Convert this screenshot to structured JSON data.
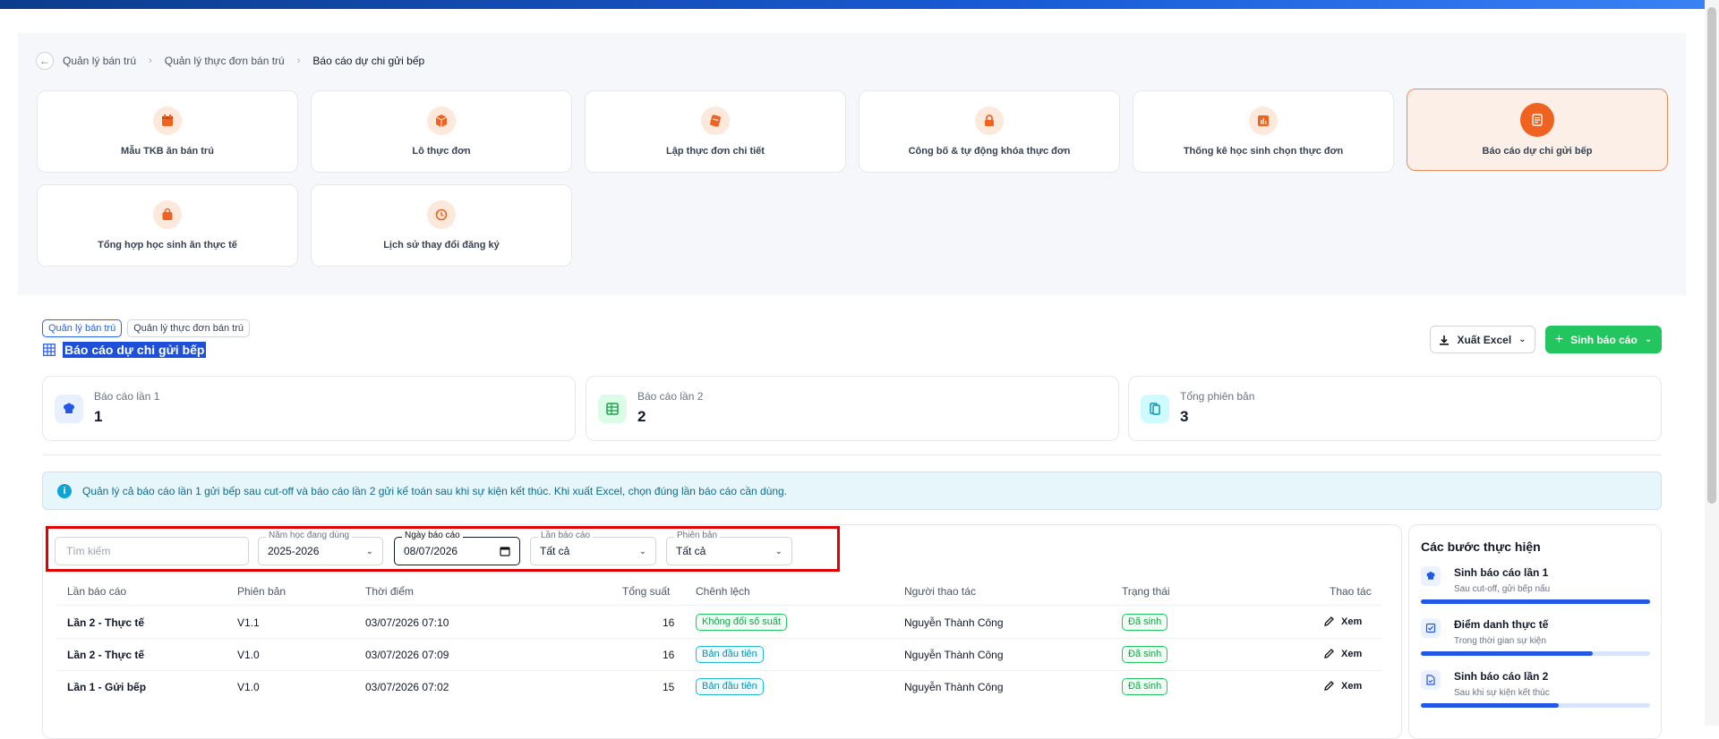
{
  "breadcrumb": {
    "items": [
      "Quản lý bán trú",
      "Quản lý thực đơn bán trú"
    ],
    "current": "Báo cáo dự chi gửi bếp"
  },
  "tiles": [
    {
      "label": "Mẫu TKB ăn bán trú",
      "icon": "calendar-icon"
    },
    {
      "label": "Lô thực đơn",
      "icon": "box-icon"
    },
    {
      "label": "Lập thực đơn chi tiết",
      "icon": "note-icon"
    },
    {
      "label": "Công bố & tự động khóa thực đơn",
      "icon": "lock-icon"
    },
    {
      "label": "Thống kê học sinh chọn thực đơn",
      "icon": "bar-chart-icon"
    },
    {
      "label": "Báo cáo dự chi gửi bếp",
      "icon": "report-icon",
      "active": true
    },
    {
      "label": "Tổng hợp học sinh ăn thực tế",
      "icon": "bag-icon"
    },
    {
      "label": "Lịch sử thay đổi đăng ký",
      "icon": "history-icon"
    }
  ],
  "header": {
    "tags": [
      "Quản lý bán trú",
      "Quản lý thực đơn bán trú"
    ],
    "title": "Báo cáo dự chi gửi bếp",
    "export_label": "Xuất Excel",
    "generate_label": "Sinh báo cáo"
  },
  "stats": [
    {
      "label": "Báo cáo lần 1",
      "value": "1",
      "icon": "chef-hat-icon"
    },
    {
      "label": "Báo cáo lần 2",
      "value": "2",
      "icon": "table-icon"
    },
    {
      "label": "Tổng phiên bản",
      "value": "3",
      "icon": "versions-icon"
    }
  ],
  "info": "Quản lý cả báo cáo lần 1 gửi bếp sau cut-off và báo cáo lần 2 gửi kế toán sau khi sự kiện kết thúc. Khi xuất Excel, chọn đúng lần báo cáo cần dùng.",
  "filters": {
    "search_placeholder": "Tìm kiếm",
    "year": {
      "label": "Năm học đang dùng",
      "value": "2025-2026"
    },
    "date": {
      "label": "Ngày báo cáo",
      "value": "08/07/2026"
    },
    "round": {
      "label": "Lần báo cáo",
      "value": "Tất cả"
    },
    "version": {
      "label": "Phiên bản",
      "value": "Tất cả"
    }
  },
  "table": {
    "columns": [
      "Lần báo cáo",
      "Phiên bản",
      "Thời điểm",
      "Tổng suất",
      "Chênh lệch",
      "Người thao tác",
      "Trạng thái",
      "Thao tác"
    ],
    "rows": [
      {
        "round": "Lần 2 - Thực tế",
        "version": "V1.1",
        "time": "03/07/2026 07:10",
        "total": "16",
        "diff": "Không đổi số suất",
        "diff_color": "green",
        "user": "Nguyễn Thành Công",
        "status": "Đã sinh",
        "action": "Xem"
      },
      {
        "round": "Lần 2 - Thực tế",
        "version": "V1.0",
        "time": "03/07/2026 07:09",
        "total": "16",
        "diff": "Bản đầu tiên",
        "diff_color": "cyan",
        "user": "Nguyễn Thành Công",
        "status": "Đã sinh",
        "action": "Xem"
      },
      {
        "round": "Lần 1 - Gửi bếp",
        "version": "V1.0",
        "time": "03/07/2026 07:02",
        "total": "15",
        "diff": "Bản đầu tiên",
        "diff_color": "cyan",
        "user": "Nguyễn Thành Công",
        "status": "Đã sinh",
        "action": "Xem"
      }
    ]
  },
  "steps": {
    "title": "Các bước thực hiện",
    "items": [
      {
        "title": "Sinh báo cáo lần 1",
        "subtitle": "Sau cut-off, gửi bếp nấu",
        "progress": 1.0,
        "icon": "chef-hat-icon"
      },
      {
        "title": "Điểm danh thực tế",
        "subtitle": "Trong thời gian sự kiện",
        "progress": 0.75,
        "icon": "checklist-icon"
      },
      {
        "title": "Sinh báo cáo lần 2",
        "subtitle": "Sau khi sự kiện kết thúc",
        "progress": 0.6,
        "icon": "doc-check-icon"
      }
    ]
  },
  "colors": {
    "accent_orange": "#f0621f",
    "primary_blue": "#2457e6",
    "success_green": "#22c55e"
  }
}
